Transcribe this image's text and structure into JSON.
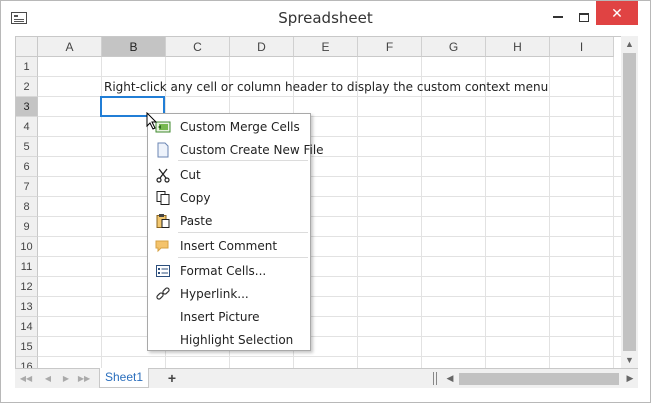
{
  "window": {
    "title": "Spreadsheet"
  },
  "title_buttons": {
    "minimize": "minimize",
    "maximize": "maximize",
    "close": "✕"
  },
  "columns": [
    "A",
    "B",
    "C",
    "D",
    "E",
    "F",
    "G",
    "H",
    "I"
  ],
  "rows": [
    "1",
    "2",
    "3",
    "4",
    "5",
    "6",
    "7",
    "8",
    "9",
    "10",
    "11",
    "12",
    "13",
    "14",
    "15",
    "16"
  ],
  "active_column": "B",
  "active_row": "3",
  "cells": {
    "B2": "Right-click any cell or column header to display the custom context menu"
  },
  "sheet_tabs": [
    {
      "label": "Sheet1",
      "active": true
    }
  ],
  "add_sheet_label": "+",
  "context_menu": {
    "items": [
      {
        "label": "Custom Merge Cells",
        "icon": "merge-cells-icon"
      },
      {
        "label": "Custom Create New File",
        "icon": "new-file-icon"
      },
      {
        "label": "Cut",
        "icon": "scissors-icon"
      },
      {
        "label": "Copy",
        "icon": "copy-icon"
      },
      {
        "label": "Paste",
        "icon": "paste-icon"
      },
      {
        "label": "Insert Comment",
        "icon": "comment-icon"
      },
      {
        "label": "Format Cells...",
        "icon": "format-cells-icon"
      },
      {
        "label": "Hyperlink...",
        "icon": "link-icon"
      },
      {
        "label": "Insert Picture",
        "icon": ""
      },
      {
        "label": "Highlight Selection",
        "icon": ""
      }
    ]
  },
  "colors": {
    "selection_border": "#217ed6",
    "active_header": "#c4c4c4",
    "close_button": "#e04343",
    "sheet_tab_text": "#2a6ebd"
  }
}
